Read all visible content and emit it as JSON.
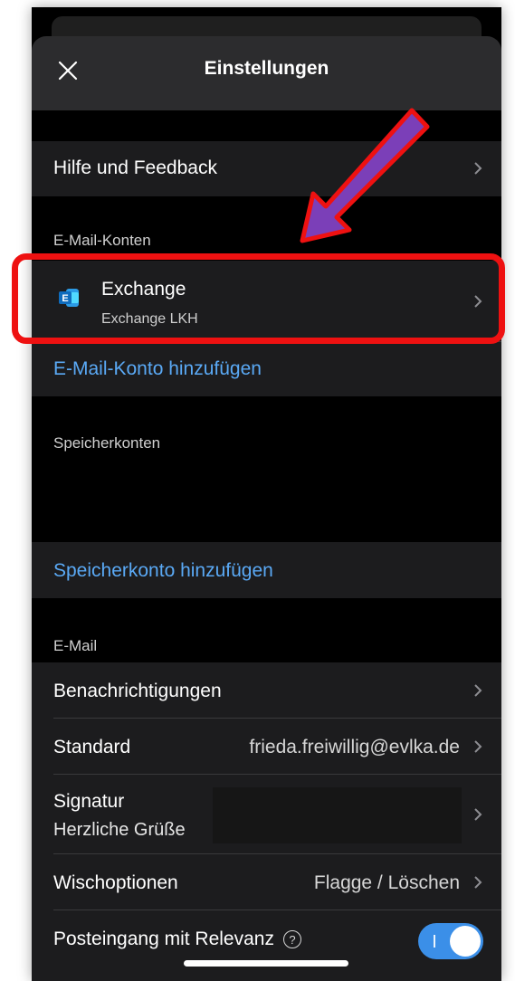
{
  "header": {
    "title": "Einstellungen",
    "close_icon": "close-icon"
  },
  "rows": {
    "help": {
      "label": "Hilfe und Feedback"
    }
  },
  "email_accounts": {
    "section_label": "E-Mail-Konten",
    "account": {
      "name": "Exchange",
      "subtitle": "Exchange LKH",
      "icon": "exchange-icon"
    },
    "add_link": "E-Mail-Konto hinzufügen"
  },
  "storage_accounts": {
    "section_label": "Speicherkonten",
    "add_link": "Speicherkonto hinzufügen"
  },
  "email": {
    "section_label": "E-Mail",
    "notifications": {
      "label": "Benachrichtigungen"
    },
    "default": {
      "label": "Standard",
      "value": "frieda.freiwillig@evlka.de"
    },
    "signature": {
      "label": "Signatur",
      "value": "Herzliche Grüße"
    },
    "swipe": {
      "label": "Wischoptionen",
      "value": "Flagge / Löschen"
    },
    "focused_inbox": {
      "label": "Posteingang mit Relevanz",
      "help_icon": "?",
      "enabled": true
    }
  },
  "colors": {
    "background": "#000000",
    "row": "#1c1c1e",
    "header": "#2c2c2e",
    "link": "#5aa9f5",
    "toggle_on": "#3b8fe8",
    "annotation_red": "#ee1111",
    "annotation_arrow_fill": "#7b3fb8"
  }
}
